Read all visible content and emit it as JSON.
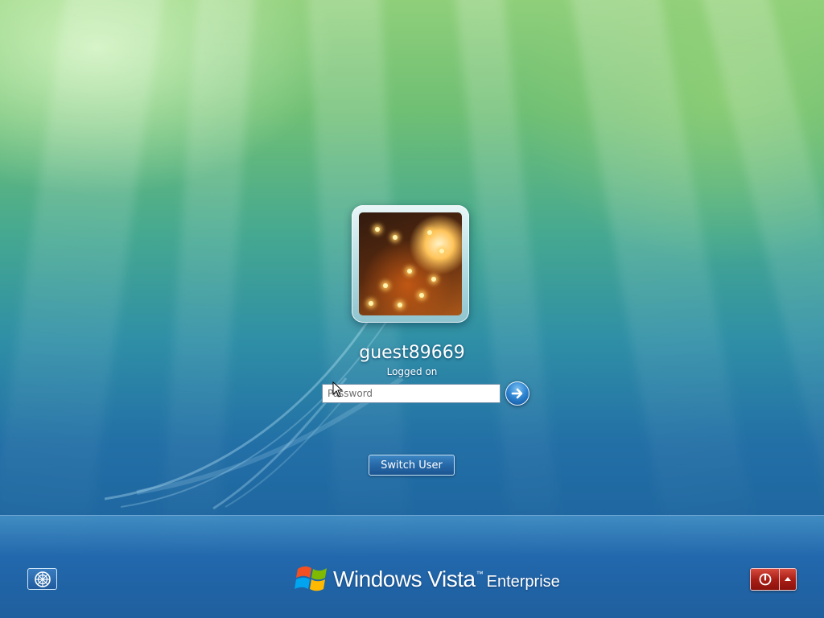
{
  "login": {
    "username": "guest89669",
    "status": "Logged on",
    "password_placeholder": "Password",
    "password_value": "",
    "submit_icon": "arrow-right-icon",
    "switch_user_label": "Switch User"
  },
  "footer": {
    "ease_of_access_icon": "ease-of-access-icon",
    "brand_windows": "Windows Vista",
    "brand_tm": "™",
    "brand_edition": "Enterprise",
    "power_icon": "power-icon",
    "power_menu_icon": "triangle-up-icon"
  },
  "colors": {
    "background_top": "#8fcf7a",
    "background_bottom": "#1a5b98",
    "accent_blue": "#2668a8",
    "power_red": "#a91f17"
  }
}
